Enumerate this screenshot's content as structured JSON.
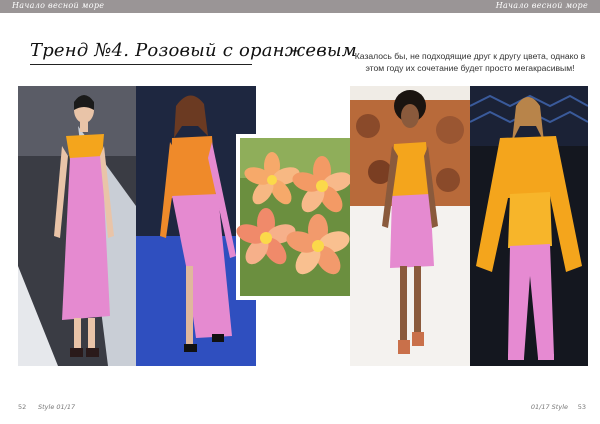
{
  "header": {
    "left_text": "Начало весной море",
    "right_text": "Начало весной море"
  },
  "article": {
    "title": "Тренд №4. Розовый с оранжевым",
    "description": "Казалось бы, не подходящие друг к другу цвета, однако в этом году их сочетание будет просто мегакрасивым!"
  },
  "footer": {
    "page_left": "52",
    "magazine_left": "Style 01/17",
    "magazine_right": "01/17 Style",
    "page_right": "53"
  },
  "colors": {
    "pink": "#e58ad0",
    "orange": "#f4a51c",
    "band": "#9a9596",
    "runway_blue": "#2f4fbf"
  }
}
